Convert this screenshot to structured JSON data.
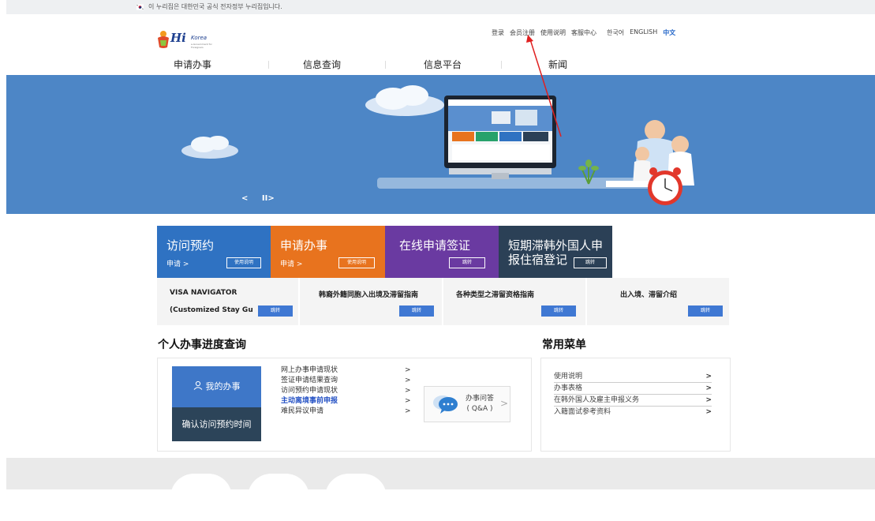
{
  "top_notice": {
    "text": "이 누리집은 대한민국 공식 전자정부 누리집입니다."
  },
  "logo": {
    "hi": "Hi",
    "korea": "Korea",
    "tagline": "e-Government for Foreigners"
  },
  "utils": {
    "login": "登录",
    "register": "会员注册",
    "guide": "使用说明",
    "support": "客服中心",
    "korean": "한국어",
    "english": "ENGLISH",
    "chinese": "中文"
  },
  "gnb": [
    "申请办事",
    "信息查询",
    "信息平台",
    "新闻"
  ],
  "hero": {
    "prev": "<",
    "pause": "II>"
  },
  "cards": [
    {
      "title": "访问预约",
      "sub": "申请 >",
      "btn": "使用说明",
      "color": "#2f72c2"
    },
    {
      "title": "申请办事",
      "sub": "申请 >",
      "btn": "使用说明",
      "color": "#e8731e"
    },
    {
      "title": "在线申请签证",
      "btn": "跳转",
      "color": "#6a3aa1"
    },
    {
      "title": "短期滞韩外国人申",
      "title2": "报住宿登记",
      "btn": "跳转",
      "color": "#2b4056"
    }
  ],
  "guides": [
    {
      "title": "VISA NAVIGATOR",
      "title2": "(Customized Stay Gu",
      "btn": "跳转"
    },
    {
      "title": "韩裔外籍同胞入出境及滞留指南",
      "btn": "跳转"
    },
    {
      "title": "各种类型之滞留资格指南",
      "btn": "跳转"
    },
    {
      "title": "出入境、滞留介绍",
      "btn": "跳转"
    }
  ],
  "progress": {
    "title": "个人办事进度查询",
    "my": "我的办事",
    "confirm": "确认访问预约时间",
    "links": [
      "网上办事申请现状",
      "签证申请结果查询",
      "访问预约申请现状",
      "主动离境事前申报",
      "难民异议申请"
    ],
    "qa_line1": "办事问答",
    "qa_line2": "( Q&A )"
  },
  "favorites": {
    "title": "常用菜单",
    "items": [
      "使用说明",
      "办事表格",
      "在韩外国人及雇主申报义务",
      "入籍面试参考资料"
    ]
  }
}
